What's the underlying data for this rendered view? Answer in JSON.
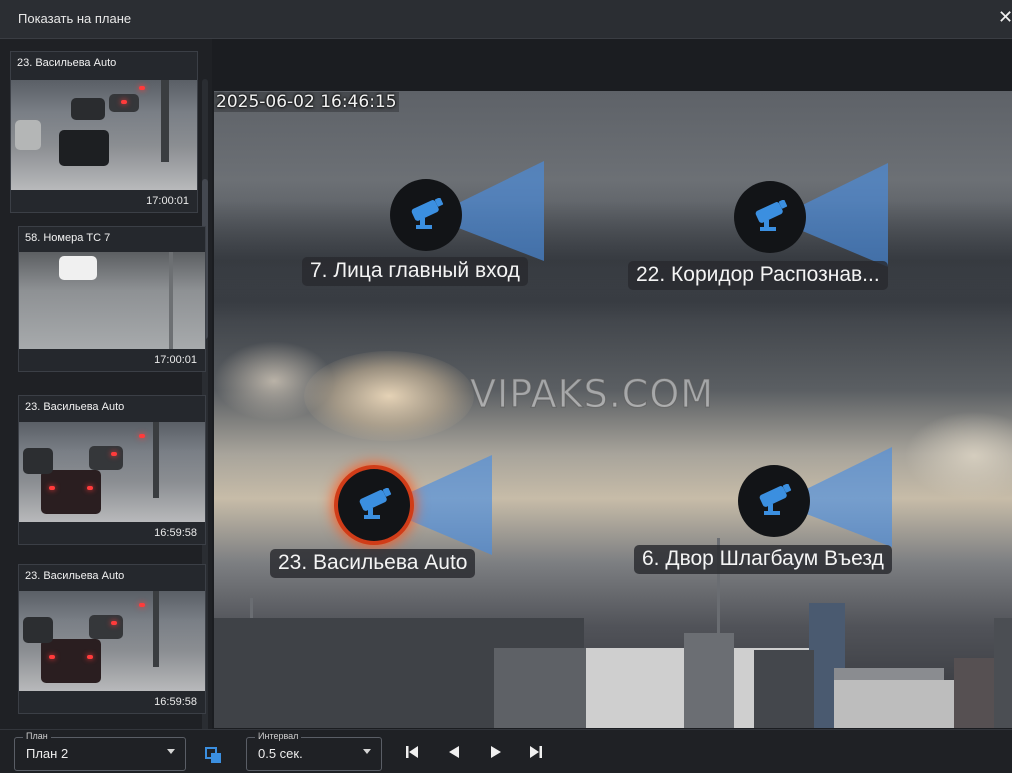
{
  "window": {
    "title": "Показать на плане",
    "close_glyph": "✕"
  },
  "sidebar": {
    "cards": [
      {
        "label": "23. Васильева Auto",
        "time": "17:00:01"
      },
      {
        "label": "58. Номера ТС 7",
        "time": "17:00:01"
      },
      {
        "label": "23. Васильева Auto",
        "time": "16:59:58"
      },
      {
        "label": "23. Васильева Auto",
        "time": "16:59:58"
      }
    ]
  },
  "plan": {
    "timestamp": "2025-06-02 16:46:15",
    "watermark": "VIPAKS.COM",
    "cameras": [
      {
        "label": "7. Лица главный вход",
        "icon": "camera-icon",
        "active": false
      },
      {
        "label": "22. Коридор Распознав...",
        "icon": "camera-icon",
        "active": false
      },
      {
        "label": "23. Васильева Auto",
        "icon": "camera-icon",
        "active": true
      },
      {
        "label": "6. Двор Шлагбаум Въезд",
        "icon": "camera-icon",
        "active": false
      }
    ]
  },
  "bottom": {
    "plan_caption": "План",
    "plan_value": "План 2",
    "interval_caption": "Интервал",
    "interval_value": "0.5 сек.",
    "buttons": [
      "step-back-icon",
      "prev-icon",
      "play-icon",
      "step-forward-icon"
    ]
  },
  "colors": {
    "camera_icon": "#3b8fe0",
    "fov": "#4a8ee0",
    "active_ring": "#d03c18",
    "background": "#1b1d21"
  }
}
